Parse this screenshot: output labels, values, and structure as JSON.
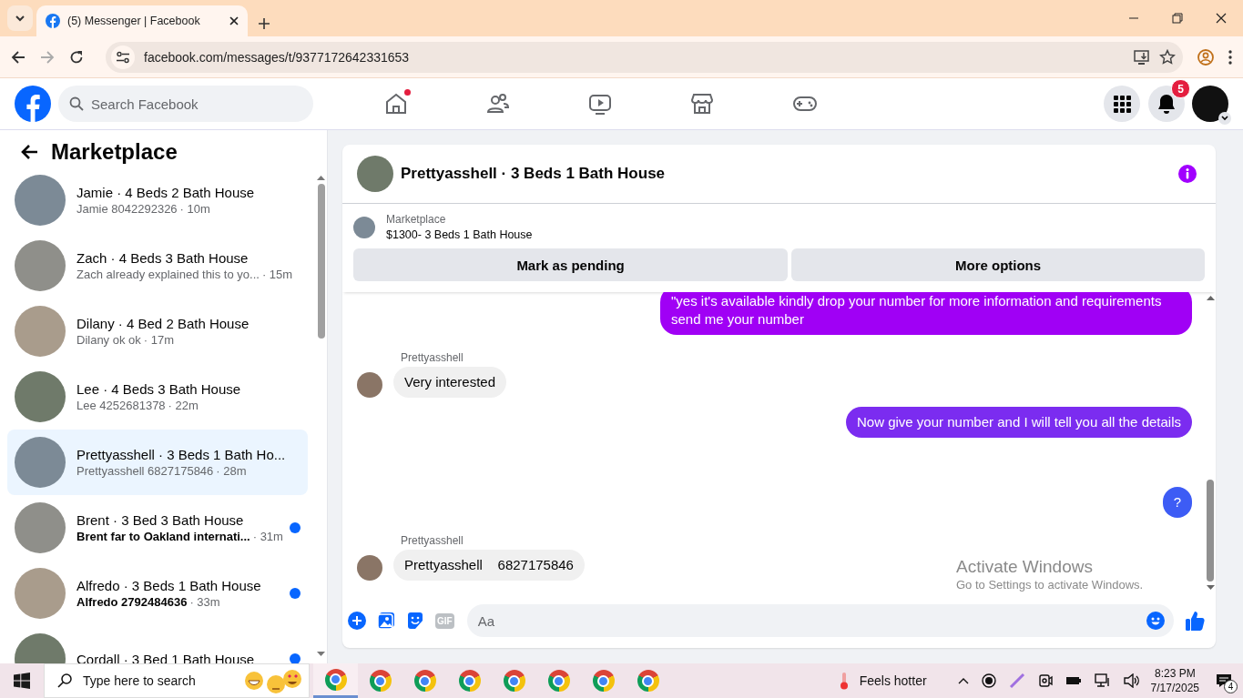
{
  "browser": {
    "tab_title": "(5) Messenger | Facebook",
    "url": "facebook.com/messages/t/9377172642331653"
  },
  "topbar": {
    "search_placeholder": "Search Facebook",
    "notification_count": "5"
  },
  "sidebar": {
    "title": "Marketplace",
    "items": [
      {
        "title": "Jamie · 4 Beds 2 Bath House",
        "preview": "Jamie 8042292326",
        "time": "· 10m",
        "unread": false,
        "selected": false
      },
      {
        "title": "Zach · 4 Beds 3 Bath House",
        "preview": "Zach already explained this to yo...",
        "time": "· 15m",
        "unread": false,
        "selected": false
      },
      {
        "title": "Dilany · 4 Bed 2 Bath House",
        "preview": "Dilany ok ok",
        "time": "· 17m",
        "unread": false,
        "selected": false
      },
      {
        "title": "Lee · 4 Beds 3 Bath House",
        "preview": "Lee 4252681378",
        "time": "· 22m",
        "unread": false,
        "selected": false
      },
      {
        "title": "Prettyasshell · 3 Beds 1 Bath Ho...",
        "preview": "Prettyasshell 6827175846",
        "time": "· 28m",
        "unread": false,
        "selected": true
      },
      {
        "title": "Brent · 3 Bed 3 Bath House",
        "preview": "Brent far to Oakland internati...",
        "time": "· 31m",
        "unread": true,
        "selected": false
      },
      {
        "title": "Alfredo · 3 Beds 1 Bath House",
        "preview": "Alfredo 2792484636",
        "time": "· 33m",
        "unread": true,
        "selected": false
      },
      {
        "title": "Cordall · 3 Bed 1 Bath House",
        "unread": true,
        "selected": false
      }
    ]
  },
  "chat": {
    "title": "Prettyasshell · 3 Beds 1 Bath House",
    "listing": {
      "label": "Marketplace",
      "name": "$1300- 3 Beds 1 Bath House"
    },
    "buttons": [
      "Mark as pending",
      "More options"
    ],
    "messages": [
      {
        "kind": "outgoing",
        "text": "\"yes it's available kindly drop your number for more information and requirements send me your number",
        "color": "#a000f5"
      },
      {
        "kind": "incoming",
        "sender": "Prettyasshell",
        "text": "Very interested"
      },
      {
        "kind": "outgoing",
        "text": "Now give your number and I will tell you all the details",
        "color": "#7b2cf0"
      },
      {
        "kind": "outgoing",
        "text": "?",
        "color": "#3d5cf5"
      },
      {
        "kind": "incoming",
        "sender": "Prettyasshell",
        "text": "Prettyasshell    6827175846"
      }
    ],
    "composer": {
      "gif_label": "GIF",
      "placeholder": "Aa"
    }
  },
  "watermark": {
    "title": "Activate Windows",
    "subtitle": "Go to Settings to activate Windows."
  },
  "taskbar": {
    "search_placeholder": "Type here to search",
    "weather": "Feels hotter",
    "time": "8:23 PM",
    "date": "7/17/2025",
    "notification_count": "4"
  }
}
